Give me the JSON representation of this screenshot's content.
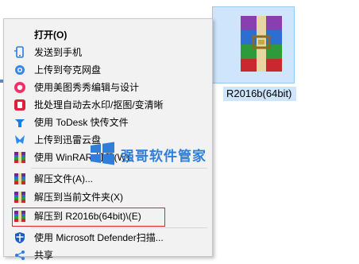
{
  "file": {
    "name": "R2016b(64bit)"
  },
  "menu": {
    "items": [
      {
        "label": "打开(O)",
        "icon": "none"
      },
      {
        "label": "发送到手机",
        "icon": "phone-send-icon"
      },
      {
        "label": "上传到夸克网盘",
        "icon": "cloud-icon"
      },
      {
        "label": "使用美图秀秀编辑与设计",
        "icon": "meitu-icon"
      },
      {
        "label": "批处理自动去水印/抠图/变清晰",
        "icon": "batch-icon"
      },
      {
        "label": "使用 ToDesk 快传文件",
        "icon": "todesk-icon"
      },
      {
        "label": "上传到迅雷云盘",
        "icon": "xunlei-icon"
      },
      {
        "label": "使用 WinRAR 打开(W)",
        "icon": "winrar-icon"
      },
      {
        "label": "解压文件(A)...",
        "icon": "winrar-icon"
      },
      {
        "label": "解压到当前文件夹(X)",
        "icon": "winrar-icon"
      },
      {
        "label": "解压到 R2016b(64bit)\\(E)",
        "icon": "winrar-icon"
      },
      {
        "label": "使用 Microsoft Defender扫描...",
        "icon": "defender-icon"
      },
      {
        "label": "共享",
        "icon": "share-icon"
      }
    ]
  },
  "watermark": {
    "text": "强哥软件管家"
  },
  "colors": {
    "highlight_border": "#e0242b",
    "menu_bg": "#f2f2f2",
    "selection": "#cfe5fb",
    "watermark": "#2f7fd8"
  }
}
